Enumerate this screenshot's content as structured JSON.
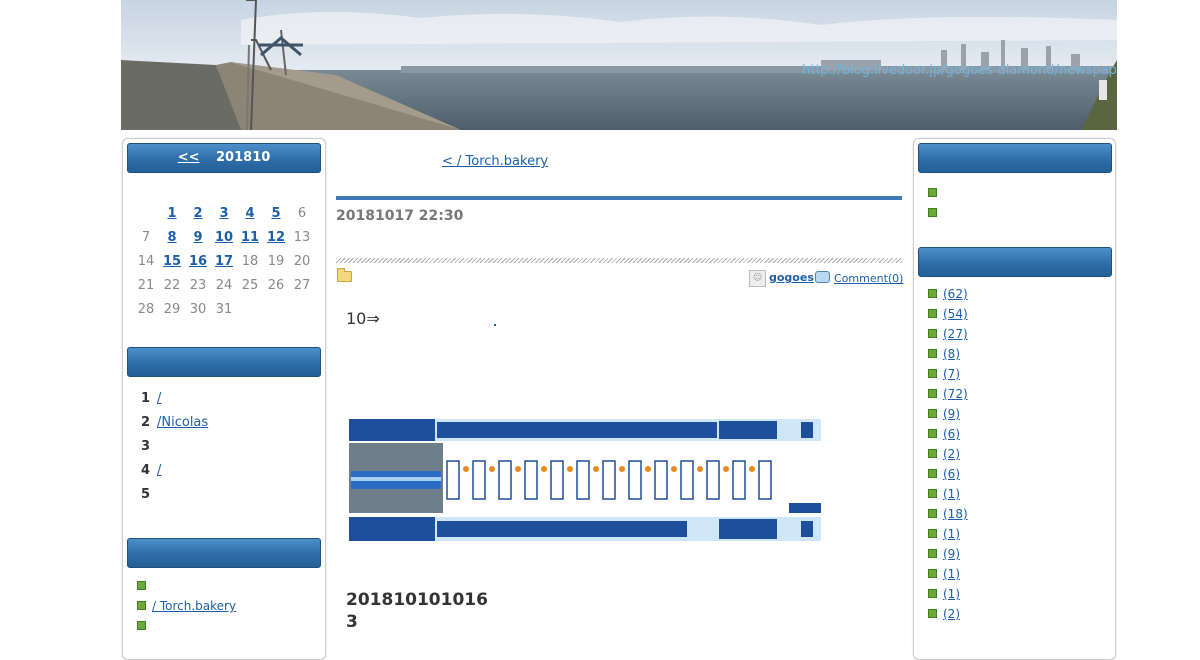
{
  "header": {
    "blog_url": "http://blog.livedoor.jp/gogoes-diamond/newspaper/"
  },
  "calendar": {
    "prev_label": "<<",
    "month_label": "201810",
    "rows": [
      [
        "",
        "1",
        "2",
        "3",
        "4",
        "5",
        "6"
      ],
      [
        "7",
        "8",
        "9",
        "10",
        "11",
        "12",
        "13"
      ],
      [
        "14",
        "15",
        "16",
        "17",
        "18",
        "19",
        "20"
      ],
      [
        "21",
        "22",
        "23",
        "24",
        "25",
        "26",
        "27"
      ],
      [
        "28",
        "29",
        "30",
        "31",
        "",
        "",
        ""
      ]
    ],
    "linked_days": [
      "1",
      "2",
      "3",
      "4",
      "5",
      "8",
      "9",
      "10",
      "11",
      "12",
      "15",
      "16",
      "17"
    ]
  },
  "ranking": {
    "title": "",
    "items": [
      {
        "num": "1",
        "label": "/          "
      },
      {
        "num": "2",
        "label": "/Nicolas    "
      },
      {
        "num": "3",
        "label": "                  "
      },
      {
        "num": "4",
        "label": "/        "
      },
      {
        "num": "5",
        "label": "               "
      }
    ]
  },
  "recent": {
    "title": "    ",
    "items": [
      {
        "label": "                    ",
        "visited": true
      },
      {
        "label": "/ Torch.bakery        ",
        "visited": false
      },
      {
        "label": "                ",
        "visited": false
      }
    ]
  },
  "right": {
    "box1_title": "",
    "box1_items": [
      "",
      ""
    ],
    "box2_title": "",
    "categories": [
      "(62)",
      "(54)",
      "(27)",
      "(8)",
      "(7)",
      "(72)",
      "(9)",
      "(6)",
      "(2)",
      "(6)",
      "(1)",
      "(18)",
      "(1)",
      "(9)",
      "(1)",
      "(1)",
      "(2)"
    ]
  },
  "article": {
    "prev_link": "< / Torch.bakery        ",
    "date": "20181017 22:30",
    "author": "gogoes",
    "comment_link": "Comment(0)",
    "body_text": "10⇒",
    "bottom_title": "201810101016 3"
  },
  "colors": {
    "title_bar": "#2f6ea8",
    "link": "#1c5fa8",
    "bullet": "#6fa83a",
    "rule": "#3d7ab5"
  }
}
